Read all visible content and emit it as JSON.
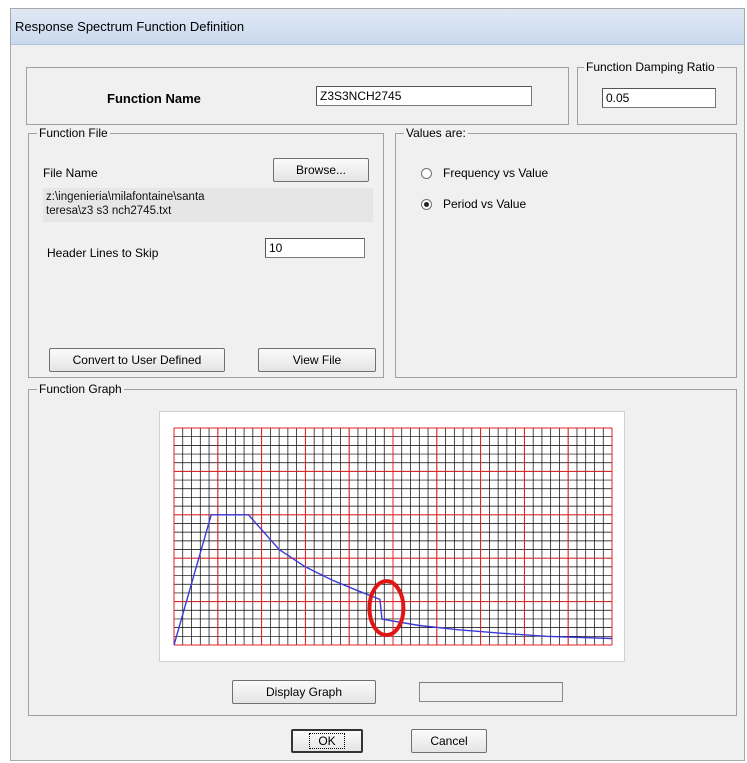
{
  "window": {
    "title": "Response Spectrum  Function Definition"
  },
  "function_name": {
    "label": "Function Name",
    "value": "Z3S3NCH2745"
  },
  "damping": {
    "group_label": "Function Damping Ratio",
    "value": "0.05"
  },
  "function_file": {
    "group_label": "Function File",
    "file_name_label": "File Name",
    "browse_label": "Browse...",
    "path_line1": "z:\\ingenieria\\milafontaine\\santa",
    "path_line2": "teresa\\z3  s3  nch2745.txt",
    "header_lines_label": "Header Lines to Skip",
    "header_lines_value": "10",
    "convert_label": "Convert to User Defined",
    "view_file_label": "View File"
  },
  "values_are": {
    "group_label": "Values are:",
    "options": [
      {
        "label": "Frequency vs Value",
        "selected": false
      },
      {
        "label": "Period vs Value",
        "selected": true
      }
    ]
  },
  "function_graph": {
    "group_label": "Function Graph",
    "display_graph_label": "Display Graph",
    "colors": {
      "grid_minor": "#000000",
      "grid_major": "#e02020",
      "curve": "#3a3ad8",
      "highlight": "#e01515"
    }
  },
  "chart_data": {
    "type": "line",
    "title": "",
    "xlabel": "",
    "ylabel": "",
    "grid": true,
    "xlim": [
      0,
      10
    ],
    "ylim": [
      0,
      5
    ],
    "series": [
      {
        "x": [
          0,
          0.85,
          1.7,
          2.4,
          3.0,
          3.6,
          4.2,
          4.7,
          4.75,
          5.0,
          5.6,
          6.5,
          7.5,
          8.5,
          10
        ],
        "y": [
          0,
          3.0,
          3.0,
          2.2,
          1.8,
          1.5,
          1.25,
          1.05,
          0.6,
          0.55,
          0.45,
          0.35,
          0.27,
          0.2,
          0.15
        ]
      }
    ],
    "highlight_marker": {
      "shape": "ellipse",
      "x": 4.85,
      "y": 0.85
    }
  },
  "dialog_buttons": {
    "ok_label": "OK",
    "cancel_label": "Cancel"
  }
}
